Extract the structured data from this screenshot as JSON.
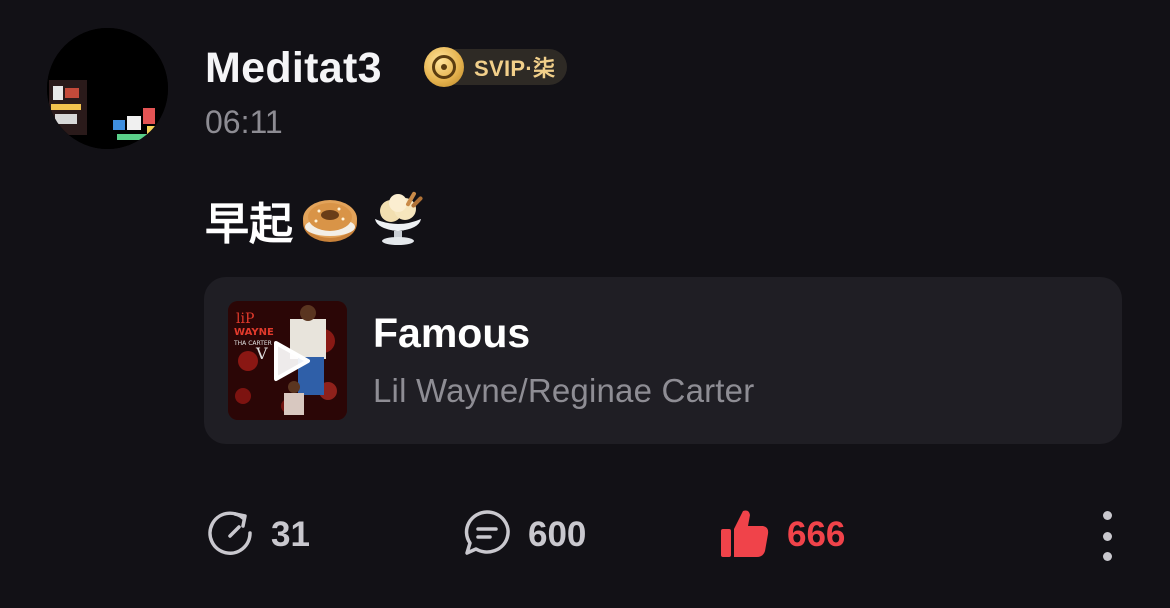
{
  "user": {
    "name": "Meditat3",
    "vip_label": "SVIP·柒",
    "timestamp": "06:11",
    "avatar_icon": "night-city-avatar",
    "badge_icon": "vinyl-disc-icon"
  },
  "post": {
    "text": "早起",
    "emojis": [
      "bagel-emoji",
      "ice-cream-emoji"
    ]
  },
  "music": {
    "title": "Famous",
    "artist": "Lil Wayne/Reginae Carter",
    "album_art_text": "LIL WAYNE THA CARTER V",
    "play_icon": "play-icon"
  },
  "actions": {
    "repost_count": "31",
    "comment_count": "600",
    "like_count": "666",
    "repost_icon": "repost-icon",
    "comment_icon": "comment-icon",
    "like_icon": "thumbs-up-icon",
    "more_icon": "more-vertical-icon"
  },
  "colors": {
    "background": "#121116",
    "card": "#1f1e24",
    "accent_red": "#f0434a",
    "vip_gold": "#f1cf8a",
    "muted_text": "#8d8c93"
  }
}
